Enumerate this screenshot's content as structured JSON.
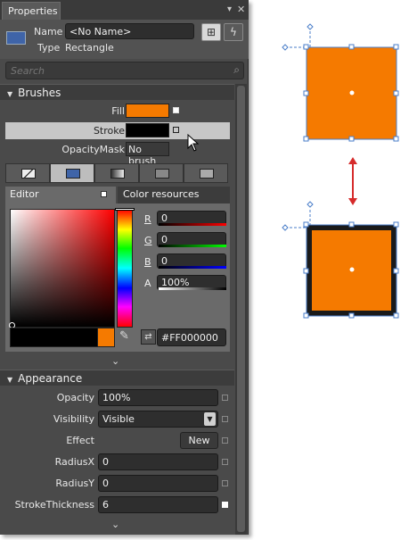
{
  "panel": {
    "tab_title": "Properties",
    "pin_icon": "pin-icon",
    "close_icon": "close-icon"
  },
  "object": {
    "name_label": "Name",
    "name_value": "<No Name>",
    "type_label": "Type",
    "type_value": "Rectangle"
  },
  "search": {
    "placeholder": "Search"
  },
  "brushes": {
    "section_title": "Brushes",
    "rows": [
      {
        "label": "Fill",
        "swatch": "#f57a00"
      },
      {
        "label": "Stroke",
        "swatch": "#000000"
      },
      {
        "label": "OpacityMask",
        "value": "No brush"
      }
    ],
    "editor_tab": "Editor",
    "resources_tab": "Color resources",
    "channels": [
      {
        "label": "R",
        "value": "0"
      },
      {
        "label": "G",
        "value": "0"
      },
      {
        "label": "B",
        "value": "0"
      },
      {
        "label": "A",
        "value": "100%"
      }
    ],
    "hex_value": "#FF000000"
  },
  "appearance": {
    "section_title": "Appearance",
    "opacity_label": "Opacity",
    "opacity_value": "100%",
    "visibility_label": "Visibility",
    "visibility_value": "Visible",
    "effect_label": "Effect",
    "effect_button": "New",
    "radiusx_label": "RadiusX",
    "radiusx_value": "0",
    "radiusy_label": "RadiusY",
    "radiusy_value": "0",
    "strokethickness_label": "StrokeThickness",
    "strokethickness_value": "6"
  },
  "colors": {
    "accent_orange": "#f57a00",
    "selection_blue": "#4a7ec9",
    "arrow_red": "#d62b2b"
  }
}
